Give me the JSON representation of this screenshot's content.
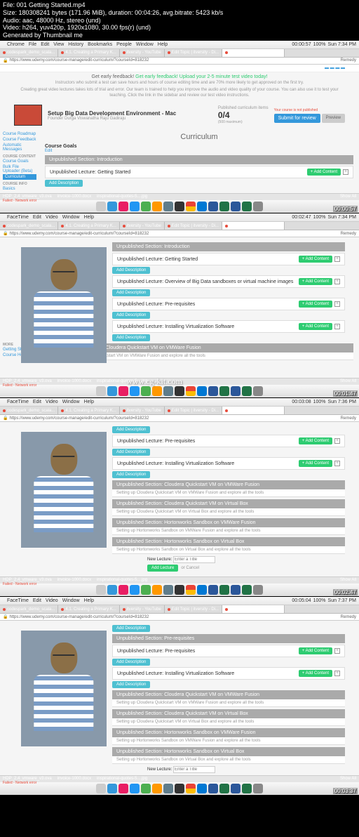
{
  "file_info": {
    "file": "File: 001 Getting Started.mp4",
    "size": "Size: 180308241 bytes (171.96 MiB), duration: 00:04:26, avg.bitrate: 5423 kb/s",
    "audio": "Audio: aac, 48000 Hz, stereo (und)",
    "video": "Video: h264, yuv420p, 1920x1080, 30.00 fps(r) (und)",
    "generated": "Generated by Thumbnail me"
  },
  "timestamps": [
    "00:00:57",
    "00:01:47",
    "00:02:47",
    "00:03:37"
  ],
  "menu": {
    "apps": [
      "Chrome",
      "FaceTime"
    ],
    "items": [
      "File",
      "Edit",
      "View",
      "History",
      "Bookmarks",
      "People",
      "Window",
      "Help"
    ],
    "items_ft": [
      "Edit",
      "Video",
      "Window",
      "Help"
    ],
    "time1": "Sun 7:34 PM",
    "time2": "Sun 7:36 PM",
    "time3": "Sun 7:37 PM",
    "battery": "100%",
    "player": "00:00:57",
    "player2": "00:02:47",
    "player3": "00:03:08",
    "player4": "00:05:04"
  },
  "tabs": [
    {
      "label": "codespark_demo_scala..."
    },
    {
      "label": "4.1. Creating a Primary K..."
    },
    {
      "label": "itversity - YouTube"
    },
    {
      "label": "Edit Topic | itversity - Di..."
    },
    {
      "label": "Setup Big Data Developm..."
    }
  ],
  "url": "https://www.udemy.com/course-manage/edit-curriculum/?courseId=818232",
  "url_remedy": "Remedy",
  "feedback": {
    "title": "Get early feedback! Upload your 2-5 minute test video today!",
    "line1": "Instructors who submit a test can save hours and hours of course editing time and are 70% more likely to get approved on the first try.",
    "line2": "Creating great video lectures takes lots of trial and error. Our team is trained to help you improve the audio and video quality of your course. You can also use it to test your teaching. Click the link in the sidebar and review our test video instructions."
  },
  "course": {
    "title": "Setup Big Data Development Environment - Mac",
    "subtitle": "Founder Durga Viswanatha Raju Gadiraju",
    "published_label": "Published curriculum items",
    "ratio": "0/4",
    "max": "(500 maximum)",
    "unpublished": "Your course is not published",
    "submit": "Submit for review",
    "preview": "Preview"
  },
  "sidebar": {
    "roadmap": "Course Roadmap",
    "feedback": "Course Feedback",
    "messages": "Automatic Messages",
    "content_head": "COURSE CONTENT",
    "goals": "Course Goals",
    "bulk": "Bulk File Uploader (Beta)",
    "curriculum": "Curriculum",
    "info_head": "COURSE INFO",
    "basics": "Basics",
    "more": "MORE",
    "survey": "Getting Started Survey",
    "help": "Course Help"
  },
  "curriculum": {
    "title": "Curriculum",
    "goals": "Course Goals",
    "edit": "Edit",
    "sections": {
      "intro": "Unpublished Section: Introduction",
      "prereq_sec": "Unpublished Section: Pre-requisites",
      "cloudera_fusion": "Unpublished Section: Cloudera Quickstart VM on VMWare Fusion",
      "cloudera_vbox": "Unpublished Section: Cloudera Quickstart VM on Virtual Box",
      "horton_fusion": "Unpublished Section: Hortonworks Sandbox on VMWare Fusion",
      "horton_vbox": "Unpublished Section: Hortonworks Sandbox on Virtual Box"
    },
    "lectures": {
      "getting_started": "Unpublished Lecture: Getting Started",
      "overview_big": "Unpublished Lecture: Overview of Big Data sandboxes or virtual machine images",
      "prereq": "Unpublished Lecture: Pre-requisites",
      "virt": "Unpublished Lecture: Installing Virtualization Software"
    },
    "subs": {
      "cloudera_fusion_sub": "Setting up Cloudera Quickstart VM on VMWare Fusion and explore all the tools",
      "cloudera_vbox_sub": "Setting up Cloudera Quickstart VM on Virtual Box and explore all the tools",
      "horton_fusion_sub": "Setting up Hortonworks Sandbox on VMWare Fusion and explore all the tools",
      "horton_vbox_sub": "Setting up Hortonworks Sandbox on Virtual Box and explore all the tools"
    },
    "add_content": "+ Add Content",
    "add_desc": "Add Description",
    "new_lecture": "New Lecture:",
    "enter_title": "Enter a Title",
    "add_lecture": "Add Lecture",
    "cancel": "or Cancel"
  },
  "files": {
    "f1": "HDP_2.4_vmware_v3.ova",
    "f1sub": "Failed - Network error",
    "f2": "invoice-1000.docx",
    "f3": "inspirational-quotes-5....jpg",
    "showall": "Show All"
  },
  "watermark": "www.cg-kit.com"
}
